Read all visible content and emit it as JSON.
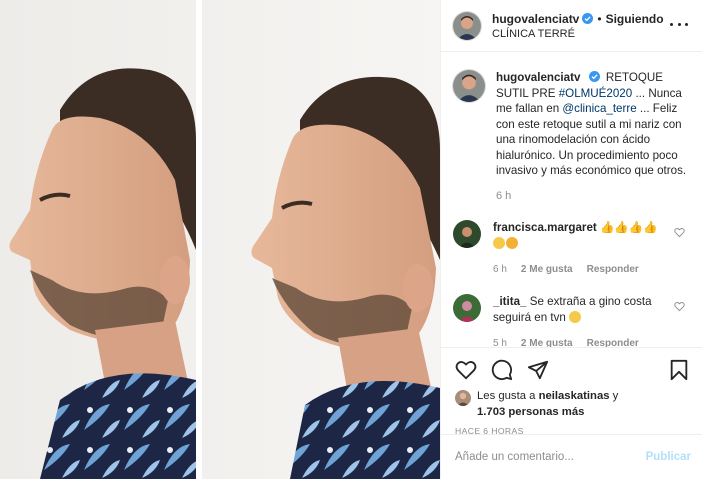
{
  "photo": {
    "description_icon": "before-after-profile-photo"
  },
  "header": {
    "username": "hugovalenciatv",
    "separator": "•",
    "follow_status": "Siguiendo",
    "location": "CLÍNICA TERRÉ",
    "verified_icon": "verified-badge-icon",
    "more_icon": "more-options-icon"
  },
  "caption": {
    "username": "hugovalenciatv",
    "text_1": "RETOQUE SUTIL PRE",
    "hashtag": "#OLMUÉ2020",
    "text_2": "... Nunca me fallan en",
    "mention": "@clinica_terre",
    "text_3": "... Feliz con este retoque sutil a mi nariz con una rinomodelación con ácido hialurónico. Un procedimiento poco invasivo y más económico que otros.",
    "time": "6 h"
  },
  "comments": [
    {
      "username": "francisca.margaret",
      "text": "👍👍👍👍",
      "extra": "",
      "time": "6 h",
      "likes": "2 Me gusta",
      "reply": "Responder"
    },
    {
      "username": "_itita_",
      "text": "Se extraña a gino costa seguirá en tvn",
      "extra": "",
      "time": "5 h",
      "likes": "2 Me gusta",
      "reply": "Responder"
    }
  ],
  "likes": {
    "prefix": "Les gusta a",
    "user": "neilaskatinas",
    "connector": "y",
    "count": "1.703 personas más"
  },
  "timestamp": "HACE 6 HORAS",
  "add_comment": {
    "placeholder": "Añade un comentario...",
    "publish_label": "Publicar"
  },
  "colors": {
    "link": "#00376b",
    "verified": "#3897f0",
    "muted": "#8e8e8e",
    "publish_disabled": "#b2dffc"
  }
}
